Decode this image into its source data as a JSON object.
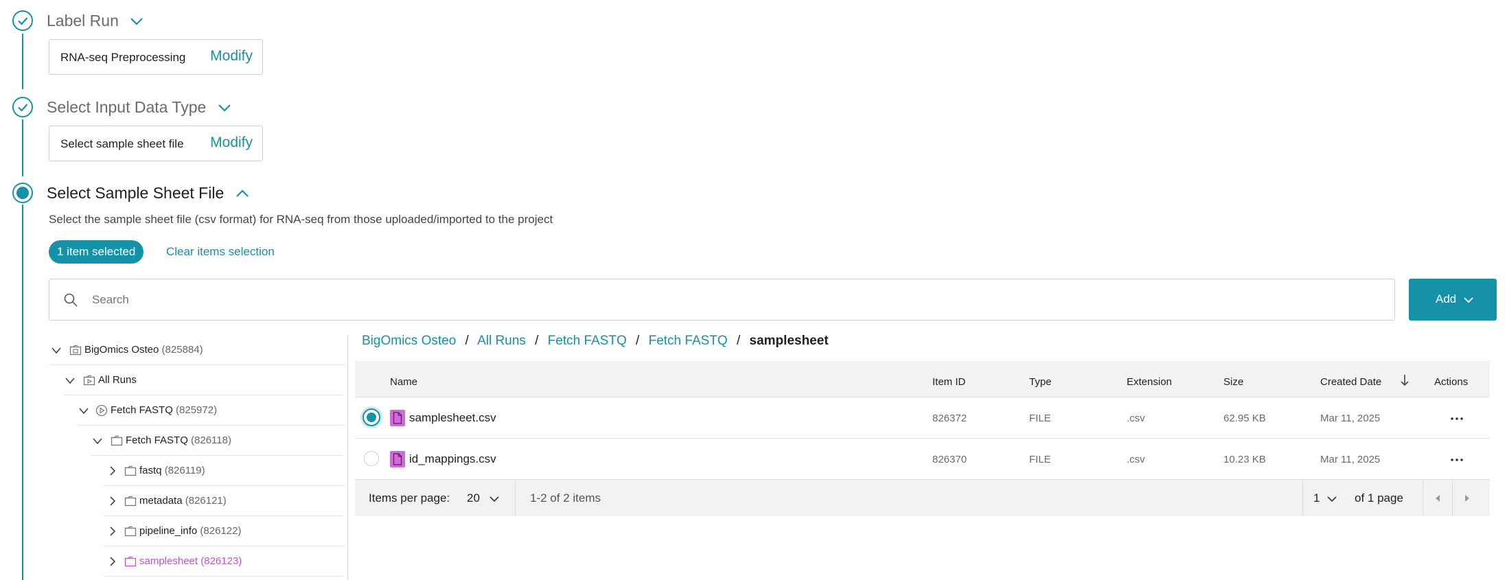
{
  "steps": [
    {
      "title": "Label Run",
      "summary": "RNA-seq Preprocessing",
      "modify_label": "Modify"
    },
    {
      "title": "Select Input Data Type",
      "summary": "Select sample sheet file",
      "modify_label": "Modify"
    },
    {
      "title": "Select Sample Sheet File",
      "description": "Select the sample sheet file (csv format) for RNA-seq from those uploaded/imported to the project",
      "selected_badge": "1 item selected",
      "clear_selection": "Clear items selection"
    }
  ],
  "search": {
    "placeholder": "Search"
  },
  "add_button": {
    "label": "Add"
  },
  "tree": [
    {
      "name": "BigOmics Osteo",
      "id": "(825884)"
    },
    {
      "name": "All Runs",
      "id": ""
    },
    {
      "name": "Fetch FASTQ",
      "id": "(825972)"
    },
    {
      "name": "Fetch FASTQ",
      "id": "(826118)"
    },
    {
      "name": "fastq",
      "id": "(826119)"
    },
    {
      "name": "metadata",
      "id": "(826121)"
    },
    {
      "name": "pipeline_info",
      "id": "(826122)"
    },
    {
      "name": "samplesheet",
      "id": "(826123)"
    }
  ],
  "breadcrumb": {
    "items": [
      "BigOmics Osteo",
      "All Runs",
      "Fetch FASTQ",
      "Fetch FASTQ"
    ],
    "current": "samplesheet",
    "separator": "/"
  },
  "table": {
    "columns": {
      "name": "Name",
      "item_id": "Item ID",
      "type": "Type",
      "extension": "Extension",
      "size": "Size",
      "created": "Created Date",
      "actions": "Actions"
    },
    "rows": [
      {
        "name": "samplesheet.csv",
        "item_id": "826372",
        "type": "FILE",
        "extension": ".csv",
        "size": "62.95 KB",
        "created": "Mar 11, 2025",
        "selected": true
      },
      {
        "name": "id_mappings.csv",
        "item_id": "826370",
        "type": "FILE",
        "extension": ".csv",
        "size": "10.23 KB",
        "created": "Mar 11, 2025",
        "selected": false
      }
    ]
  },
  "pagination": {
    "items_per_page_label": "Items per page:",
    "items_per_page": "20",
    "range": "1-2 of 2 items",
    "page": "1",
    "of_pages": "of 1 page"
  },
  "colors": {
    "accent": "#1591a8",
    "file_icon": "#cf6ad6",
    "selected_tree": "#c94fd8"
  },
  "icons": [
    "check-icon",
    "chevron-down-icon",
    "chevron-up-icon",
    "search-icon",
    "folder-icon",
    "run-icon",
    "file-icon",
    "sort-down-icon",
    "more-icon",
    "page-prev-icon",
    "page-next-icon"
  ]
}
